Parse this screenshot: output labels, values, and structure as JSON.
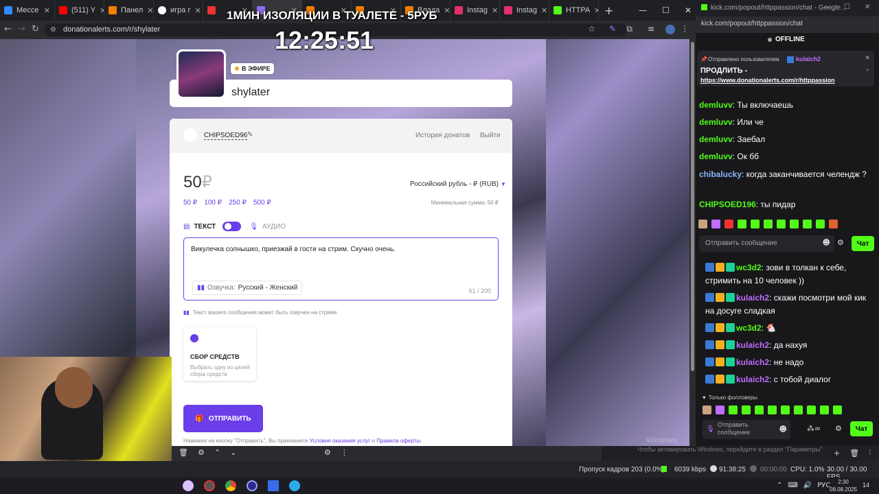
{
  "browser_left": {
    "tabs": [
      "Мессе",
      "(511) Y",
      "Панел",
      "игра г",
      "",
      "",
      "",
      "",
      "Влада",
      "Instag",
      "Instag",
      "HTTPA"
    ],
    "url": "donationalerts.com/r/shylater"
  },
  "overlay": {
    "banner": "1МИН ИЗОЛЯЦИИ В ТУАЛЕТЕ - 5РУБ",
    "timer": "12:25:51"
  },
  "donation": {
    "live_badge": "В ЭФИРЕ",
    "streamer": "shylater",
    "username": "CHIPSOED96",
    "history_link": "История донатов",
    "logout_link": "Выйти",
    "amount": "50",
    "currency_symbol": "₽",
    "currency_select": "Российский рубль - ₽ (RUB)",
    "presets": [
      "50 ₽",
      "100 ₽",
      "250 ₽",
      "500 ₽"
    ],
    "min_amount": "Минимальная сумма: 50 ₽",
    "text_label": "ТЕКСТ",
    "audio_label": "АУДИО",
    "message": "Викулечка солнышко, приезжай в гости на стрим. Скучно очень.",
    "voice_label": "Озвучка:",
    "voice_value": "Русский - Женский",
    "char_count": "61 / 200",
    "voice_hint": "Текст вашего сообщения может быть озвучен на стриме",
    "fundraise_title": "СБОР СРЕДСТВ",
    "fundraise_desc": "Выбрать одну из целей сбора средств",
    "submit": "ОТПРАВИТЬ",
    "terms_prefix": "Нажимая на кнопку \"Отправить\", Вы принимаете",
    "terms_link1": "Условия оказания услуг",
    "terms_and": "и",
    "terms_link2": "Правила оферты."
  },
  "chat_window": {
    "title": "kick.com/popout/httppassion/chat - Google...",
    "url": "kick.com/popout/httppassion/chat",
    "status": "OFFLINE",
    "pinned_by_label": "Отправлено пользователем",
    "pinned_by": "kulaich2",
    "pinned_text": "ПРОДЛИТЬ -",
    "pinned_link": "https://www.donationalerts.com/r/httppassion",
    "messages": [
      {
        "user": "demluvv",
        "text": "Ты включаешь"
      },
      {
        "user": "demluvv",
        "text": "Или че"
      },
      {
        "user": "demluvv",
        "text": "Заебал"
      },
      {
        "user": "demluvv",
        "text": "Ок бб"
      },
      {
        "user": "chibalucky",
        "text": "когда заканчивается челендж ?"
      },
      {
        "user": "CHIPSOED196",
        "text": "ты пидар"
      }
    ],
    "input_placeholder": "Отправить сообщение",
    "chat_button": "Чат"
  },
  "chat2": {
    "messages": [
      {
        "user": "wc3d2",
        "text": "зови в толкан к себе, стримить на 10 человек ))"
      },
      {
        "user": "kulaich2",
        "text": "скажи посмотри мой кик на досуге сладкая"
      },
      {
        "user": "wc3d2",
        "text": ""
      },
      {
        "user": "kulaich2",
        "text": "да нахуя"
      },
      {
        "user": "kulaich2",
        "text": "не надо"
      },
      {
        "user": "kulaich2",
        "text": "с тобой диалог"
      }
    ],
    "followers_only": "Только фолловеры",
    "input_placeholder": "Отправить сообщение",
    "chat_button": "Чат"
  },
  "obs": {
    "watermark": "Windows",
    "activate": "Чтобы активировать Windows, перейдите в раздел \"Параметры\"",
    "dropped": "Пропуск кадров 203 (0.0%)",
    "bitrate": "6039 kbps",
    "live_time": "91:38:25",
    "rec_time": "00:00:00",
    "cpu": "CPU: 1.0%",
    "fps": "30.00 / 30.00 FPS"
  },
  "taskbar": {
    "lang": "РУС",
    "time": "2:30",
    "date": "08.08.2025",
    "notif": "14"
  },
  "colors": {
    "accent": "#6a3ee8",
    "kick_green": "#53fc18"
  }
}
